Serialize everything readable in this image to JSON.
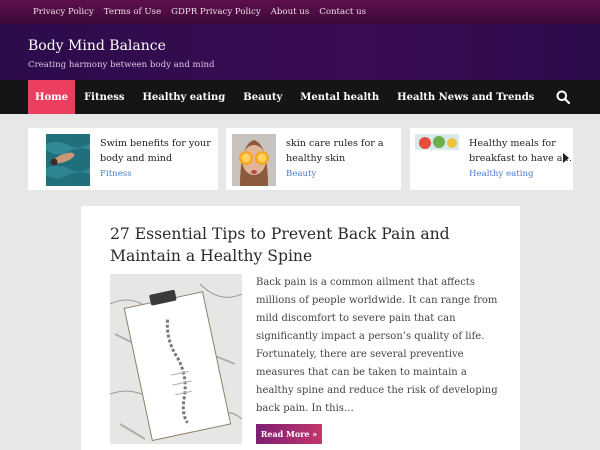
{
  "topbar": {
    "links": [
      "Privacy Policy",
      "Terms of Use",
      "GDPR Privacy Policy",
      "About us",
      "Contact us"
    ]
  },
  "header": {
    "site_title": "Body Mind Balance",
    "tagline": "Creating harmony between body and mind"
  },
  "nav": {
    "items": [
      "Home",
      "Fitness",
      "Healthy eating",
      "Beauty",
      "Mental health",
      "Health News and Trends"
    ],
    "active_index": 0,
    "search_icon": "search-icon"
  },
  "slider": {
    "cards": [
      {
        "title_line1": "Swim benefits for your",
        "title_line2": "body and mind",
        "category": "Fitness"
      },
      {
        "title_line1": "skin care rules for a",
        "title_line2": "healthy skin",
        "category": "Beauty"
      },
      {
        "title_line1": "Healthy meals for",
        "title_line2": "breakfast to have a…",
        "category": "Healthy eating"
      }
    ],
    "prev_icon": "chevron-left-icon",
    "next_icon": "chevron-right-icon"
  },
  "article": {
    "title": "27 Essential Tips to Prevent Back Pain and Maintain a Healthy Spine",
    "excerpt": "Back pain is a common ailment that affects millions of people worldwide. It can range from mild discomfort to severe pain that can significantly impact a person’s quality of life. Fortunately, there are several preventive measures that can be taken to maintain a healthy spine and reduce the risk of developing back pain. In this…",
    "read_more": "Read More »"
  },
  "colors": {
    "topbar": "#4b0c42",
    "header": "#340b4f",
    "nav": "#151515",
    "active_nav": "#ec3f5f",
    "category_link": "#4a7bd0"
  }
}
